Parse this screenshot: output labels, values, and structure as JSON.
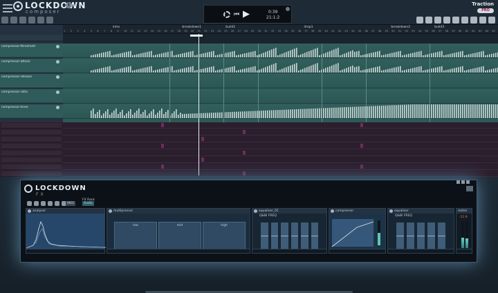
{
  "app": {
    "logo": "LOCKDOWN",
    "logo_sub": "composer",
    "info_icon": "info-icon"
  },
  "transport": {
    "time_primary": "0:39",
    "time_secondary": "21:1:2",
    "icons": [
      "loop-spinner-icon",
      "skip-back-icon",
      "play-icon"
    ]
  },
  "brand": {
    "name": "Traction",
    "badge": "PRO"
  },
  "timeline": {
    "sections": [
      {
        "label": "intro",
        "at": 0.13
      },
      {
        "label": "breakdown1",
        "at": 0.29
      },
      {
        "label": "build1",
        "at": 0.39
      },
      {
        "label": "drop1",
        "at": 0.57
      },
      {
        "label": "breakdown2",
        "at": 0.77
      },
      {
        "label": "build3",
        "at": 0.87
      }
    ],
    "bars": [
      "1",
      "2",
      "3",
      "4",
      "5",
      "6",
      "7",
      "8",
      "9",
      "10",
      "11",
      "12",
      "13",
      "14",
      "15",
      "16",
      "17",
      "18",
      "19",
      "20",
      "21",
      "22",
      "23",
      "24",
      "25",
      "26",
      "27",
      "28",
      "29",
      "30",
      "31",
      "32",
      "33",
      "34",
      "35",
      "36",
      "37",
      "38",
      "39",
      "40",
      "41",
      "42",
      "43",
      "44",
      "45",
      "46",
      "47",
      "48",
      "49",
      "50",
      "51",
      "52",
      "53",
      "54",
      "55",
      "56",
      "57",
      "58",
      "59",
      "60",
      "61",
      "62",
      "63",
      "64",
      "65"
    ]
  },
  "lanes": [
    {
      "name": "compressor-threshold"
    },
    {
      "name": "compressor-attack"
    },
    {
      "name": "compressor-release"
    },
    {
      "name": "compressor-ratio"
    },
    {
      "name": "compressor-knee"
    }
  ],
  "fx": {
    "logo": "LOCKDOWN",
    "logo_sub": "FX",
    "rack_label": "FX Rack",
    "rack_tags": [
      {
        "text": "MIDI",
        "color": "#c7d2dc"
      },
      {
        "text": "Audio",
        "color": "#5fd0d6"
      }
    ],
    "plugins": [
      {
        "title": "analyser",
        "kind": "analyser"
      },
      {
        "title": "multipressor",
        "kind": "multiband",
        "bands": [
          "low",
          "mid",
          "high"
        ]
      },
      {
        "title": "equaliser_01",
        "kind": "eq",
        "preset": "Q&Bl FREQ"
      },
      {
        "title": "compressor",
        "kind": "compressor"
      },
      {
        "title": "equaliser",
        "kind": "eq",
        "preset": "Q&Bl FREQ"
      },
      {
        "title": "meter",
        "kind": "meter",
        "value": "-11.9"
      }
    ]
  }
}
